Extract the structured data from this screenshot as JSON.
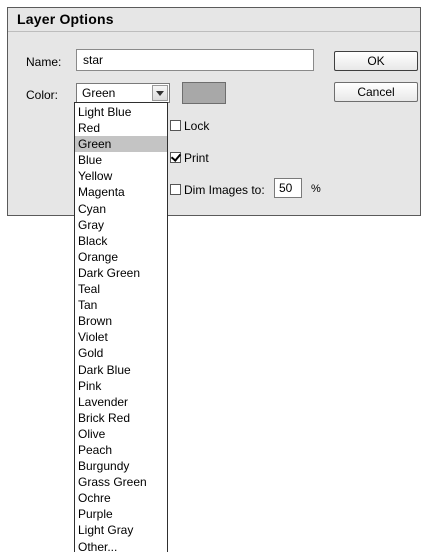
{
  "dialog": {
    "title": "Layer Options",
    "name_label": "Name:",
    "name_value": "star",
    "color_label": "Color:",
    "color_selected": "Green",
    "swatch_color": "#a8a8a8",
    "buttons": {
      "ok": "OK",
      "cancel": "Cancel"
    },
    "options": {
      "lock_label": "Lock",
      "lock_checked": false,
      "print_label": "Print",
      "print_checked": true,
      "dim_label": "Dim Images to:",
      "dim_checked": false,
      "dim_value": "50",
      "dim_unit": "%"
    }
  },
  "color_dropdown": {
    "selected_index": 2,
    "items": [
      "Light Blue",
      "Red",
      "Green",
      "Blue",
      "Yellow",
      "Magenta",
      "Cyan",
      "Gray",
      "Black",
      "Orange",
      "Dark Green",
      "Teal",
      "Tan",
      "Brown",
      "Violet",
      "Gold",
      "Dark Blue",
      "Pink",
      "Lavender",
      "Brick Red",
      "Olive",
      "Peach",
      "Burgundy",
      "Grass Green",
      "Ochre",
      "Purple",
      "Light Gray",
      "Other..."
    ]
  }
}
